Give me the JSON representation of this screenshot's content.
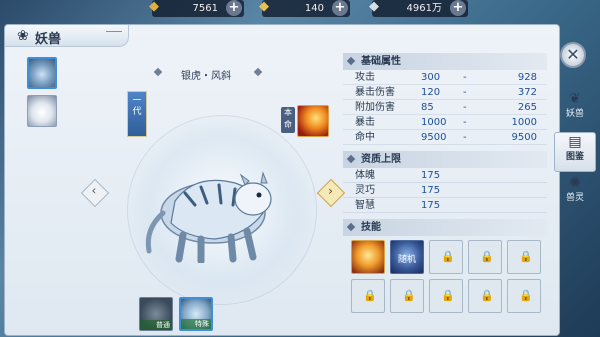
{
  "resources": [
    {
      "icon": "gold-ingot-icon",
      "value": "7561"
    },
    {
      "icon": "gold-ingot-icon",
      "value": "140"
    },
    {
      "icon": "silver-ingot-icon",
      "value": "4961万"
    }
  ],
  "panel": {
    "title": "妖兽",
    "title_icon": "beast-emblem-icon"
  },
  "beast": {
    "name": "银虎・风斜",
    "generation_char1": "一",
    "generation_char2": "代",
    "benming_char1": "本",
    "benming_char2": "命"
  },
  "forms": [
    {
      "label": "普通"
    },
    {
      "label": "特殊"
    }
  ],
  "base_attributes": {
    "title": "基础属性",
    "rows": [
      {
        "label": "攻击",
        "min": "300",
        "sep": "-",
        "max": "928"
      },
      {
        "label": "暴击伤害",
        "min": "120",
        "sep": "-",
        "max": "372"
      },
      {
        "label": "附加伤害",
        "min": "85",
        "sep": "-",
        "max": "265"
      },
      {
        "label": "暴击",
        "min": "1000",
        "sep": "-",
        "max": "1000"
      },
      {
        "label": "命中",
        "min": "9500",
        "sep": "-",
        "max": "9500"
      }
    ]
  },
  "aptitude": {
    "title": "资质上限",
    "rows": [
      {
        "label": "体魄",
        "value": "175"
      },
      {
        "label": "灵巧",
        "value": "175"
      },
      {
        "label": "智慧",
        "value": "175"
      }
    ]
  },
  "skills": {
    "title": "技能",
    "random_label": "随机"
  },
  "side_tabs": [
    {
      "label": "妖兽",
      "icon": "beast-icon"
    },
    {
      "label": "图鉴",
      "icon": "book-icon"
    },
    {
      "label": "兽灵",
      "icon": "spirit-icon"
    }
  ]
}
